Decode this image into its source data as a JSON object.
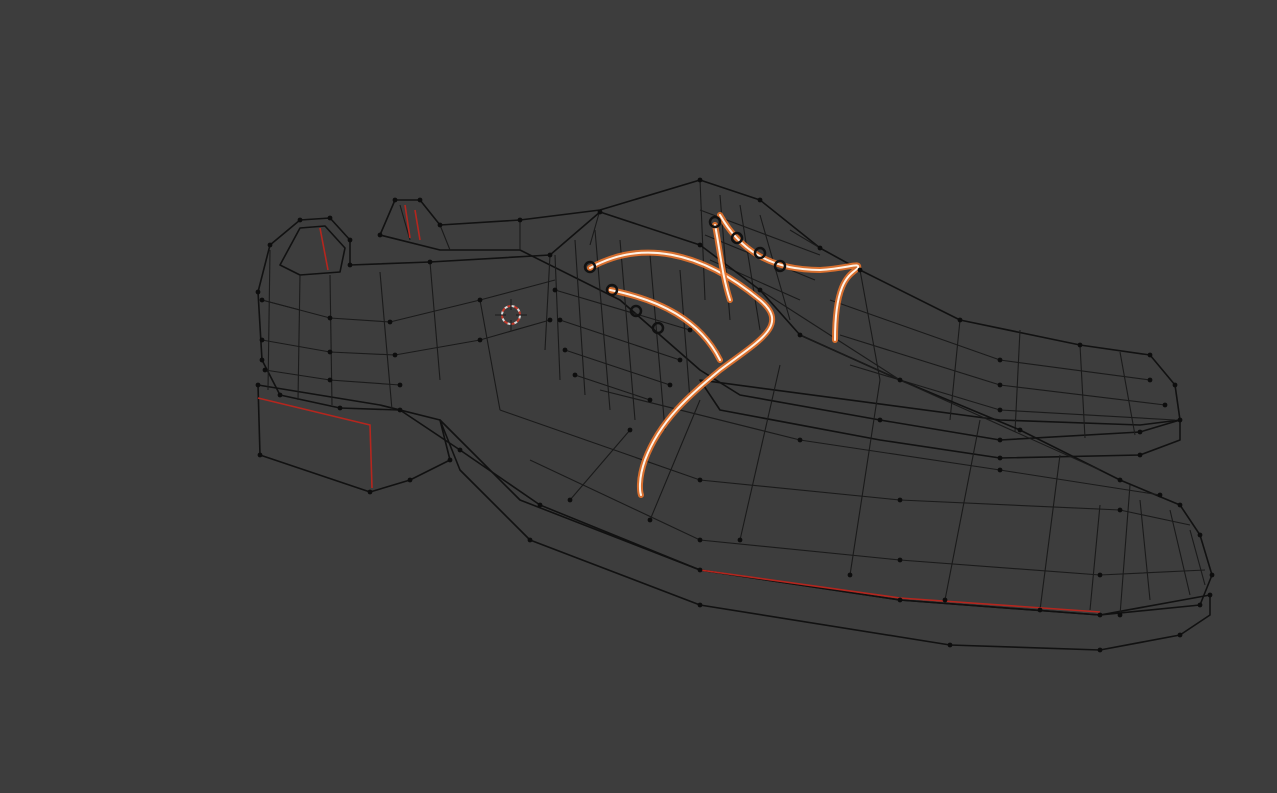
{
  "viewport": {
    "background": "#3d3d3d",
    "view_mode": "edit-mode-wireframe-overlay"
  },
  "scene": {
    "objects": [
      {
        "name": "shoe-front",
        "kind": "mesh"
      },
      {
        "name": "shoe-back",
        "kind": "mesh"
      },
      {
        "name": "laces",
        "kind": "curve"
      }
    ],
    "colors": {
      "mesh_base": "#c9d3e6",
      "mesh_highlight": "#e9eef7",
      "mesh_shadow": "#9aa6bd",
      "wire": "#111111",
      "seam": "#b5261e",
      "lace": "#e8742e"
    },
    "cursor_icon": "3d-cursor-icon"
  }
}
